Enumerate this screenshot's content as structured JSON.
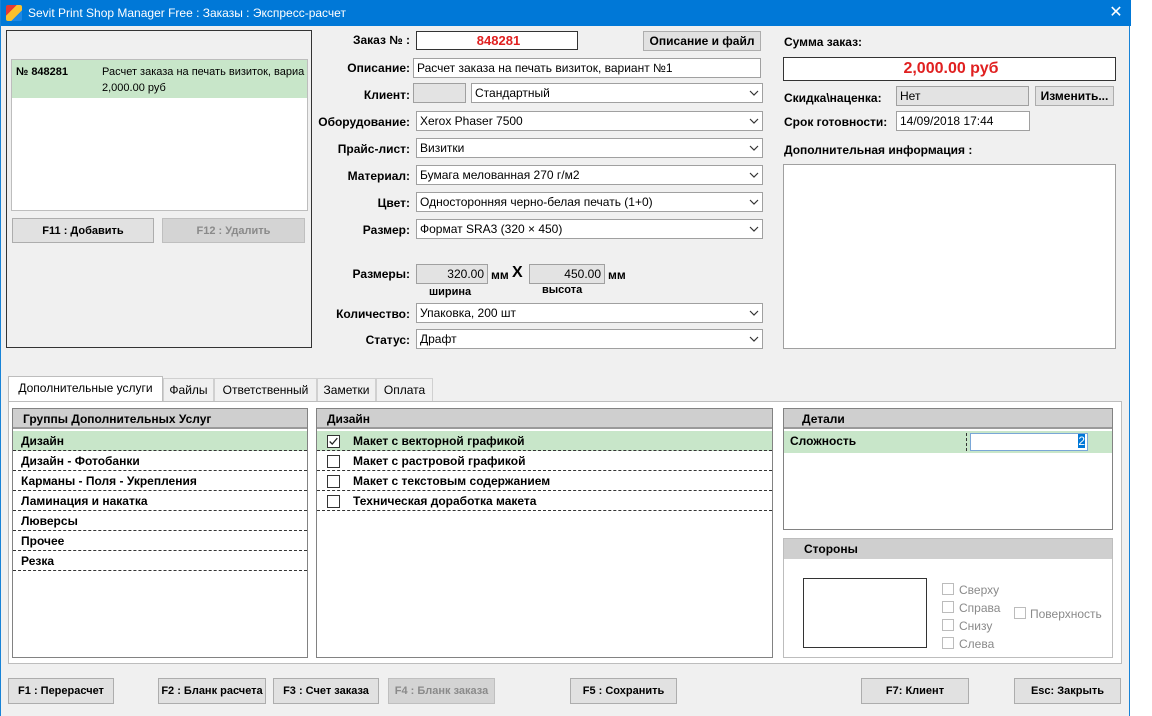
{
  "window": {
    "title": "Sevit Print Shop Manager Free : Заказы : Экспресс-расчет",
    "close_glyph": "✕"
  },
  "order_list": {
    "items": [
      {
        "number": "№ 848281",
        "description": "Расчет заказа на печать визиток, вариа",
        "price": "2,000.00 руб"
      }
    ],
    "add_label": "F11 : Добавить",
    "delete_label": "F12 : Удалить"
  },
  "form": {
    "order_label": "Заказ № :",
    "order_number": "848281",
    "desc_file_label": "Описание и файл",
    "description_label": "Описание:",
    "description_value": "Расчет заказа на печать визиток, вариант №1",
    "client_label": "Клиент:",
    "client_value": "Стандартный",
    "equipment_label": "Оборудование:",
    "equipment_value": "Xerox Phaser 7500",
    "pricelist_label": "Прайс-лист:",
    "pricelist_value": "Визитки",
    "material_label": "Материал:",
    "material_value": "Бумага мелованная 270 г/м2",
    "color_label": "Цвет:",
    "color_value": "Односторонняя черно-белая печать (1+0)",
    "size_label": "Размер:",
    "size_value": "Формат SRA3 (320 × 450)",
    "dims_label": "Размеры:",
    "width_value": "320.00",
    "height_value": "450.00",
    "unit": "мм",
    "times": "X",
    "width_caption": "ширина",
    "height_caption": "высота",
    "quantity_label": "Количество:",
    "quantity_value": "Упаковка, 200 шт",
    "status_label": "Статус:",
    "status_value": "Драфт"
  },
  "summary": {
    "sum_label": "Сумма заказ:",
    "sum_value": "2,000.00 руб",
    "discount_label": "Скидка\\наценка:",
    "discount_value": "Нет",
    "change_label": "Изменить...",
    "deadline_label": "Срок готовности:",
    "deadline_value": "14/09/2018 17:44",
    "info_label": "Дополнительная информация :"
  },
  "tabs": [
    "Дополнительные услуги",
    "Файлы",
    "Ответственный",
    "Заметки",
    "Оплата"
  ],
  "groups": {
    "header": "Группы Дополнительных Услуг",
    "items": [
      "Дизайн",
      "Дизайн - Фотобанки",
      "Карманы - Поля - Укрепления",
      "Ламинация и накатка",
      "Люверсы",
      "Прочее",
      "Резка"
    ]
  },
  "services": {
    "header": "Дизайн",
    "items": [
      {
        "label": "Макет с векторной графикой",
        "checked": true
      },
      {
        "label": "Макет с растровой графикой",
        "checked": false
      },
      {
        "label": "Макет с текстовым содержанием",
        "checked": false
      },
      {
        "label": "Техническая доработка макета",
        "checked": false
      }
    ]
  },
  "details": {
    "header": "Детали",
    "param_label": "Сложность",
    "param_value": "2"
  },
  "sides": {
    "header": "Стороны",
    "top": "Сверху",
    "right": "Справа",
    "bottom": "Снизу",
    "left": "Слева",
    "surface": "Поверхность"
  },
  "footer": {
    "recalc": "F1 : Перерасчет",
    "calc_form": "F2 : Бланк расчета",
    "invoice": "F3 : Счет заказа",
    "order_form": "F4 : Бланк заказа",
    "save": "F5 : Сохранить",
    "client": "F7: Клиент",
    "close": "Esc: Закрыть"
  },
  "colors": {
    "accent": "#0078d7",
    "selection": "#c8e6c9",
    "sum_red": "#e02020"
  }
}
